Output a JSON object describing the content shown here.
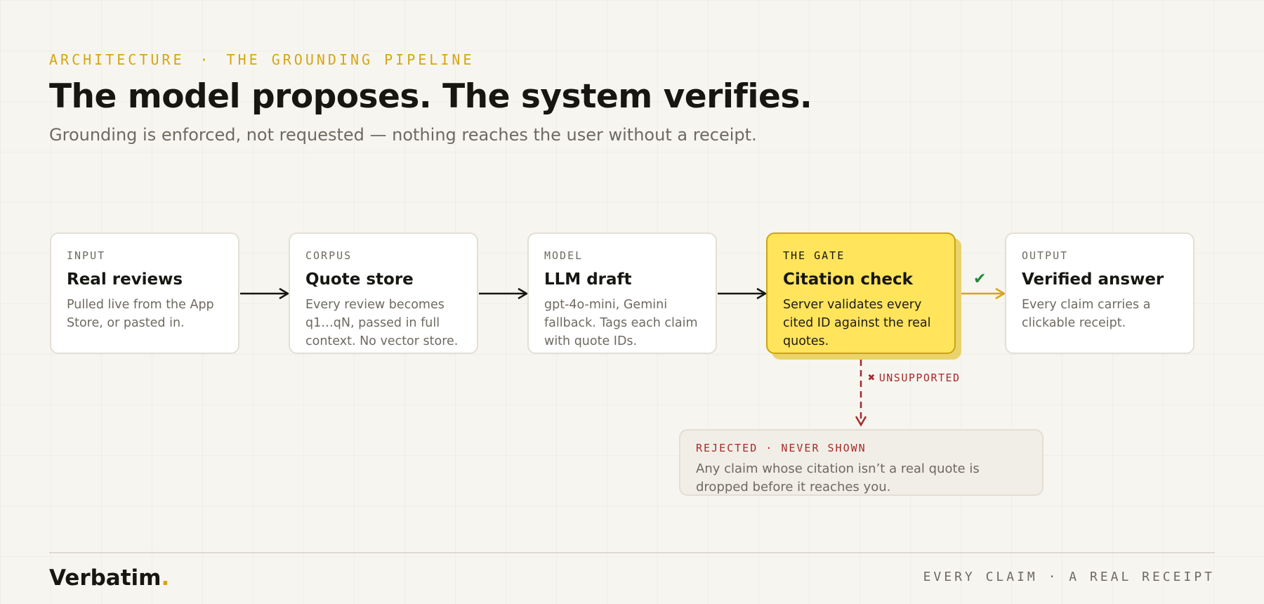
{
  "header": {
    "eyebrow_section": "ARCHITECTURE",
    "eyebrow_sep": "·",
    "eyebrow_topic": "THE GROUNDING PIPELINE",
    "title": "The model proposes. The system verifies.",
    "subtitle": "Grounding is enforced, not requested — nothing reaches the user without a receipt."
  },
  "pipeline": [
    {
      "label": "INPUT",
      "name": "Real reviews",
      "desc": "Pulled live from the App Store, or pasted in."
    },
    {
      "label": "CORPUS",
      "name": "Quote store",
      "desc": "Every review becomes q1…qN, passed in full context. No vector store."
    },
    {
      "label": "MODEL",
      "name": "LLM draft",
      "desc": "gpt-4o-mini, Gemini fallback. Tags each claim with quote IDs."
    },
    {
      "label": "THE GATE",
      "name": "Citation check",
      "desc": "Server validates every cited ID against the real quotes."
    },
    {
      "label": "OUTPUT",
      "name": "Verified answer",
      "desc": "Every claim carries a clickable receipt."
    }
  ],
  "branch": {
    "pass_mark": "✔",
    "fail_mark": "✖",
    "fail_label": "UNSUPPORTED"
  },
  "rejected": {
    "label": "REJECTED · NEVER SHOWN",
    "desc": "Any claim whose citation isn’t a real quote is dropped before it reaches you."
  },
  "footer": {
    "brand": "Verbatim",
    "brand_dot": ".",
    "tagline": "EVERY CLAIM · A REAL RECEIPT"
  },
  "colors": {
    "accent": "#d4a712",
    "gate_fill": "#ffe45c",
    "reject": "#a82a2a",
    "pass": "#1f8a3a",
    "ink": "#171613",
    "muted": "#6e6a61"
  }
}
